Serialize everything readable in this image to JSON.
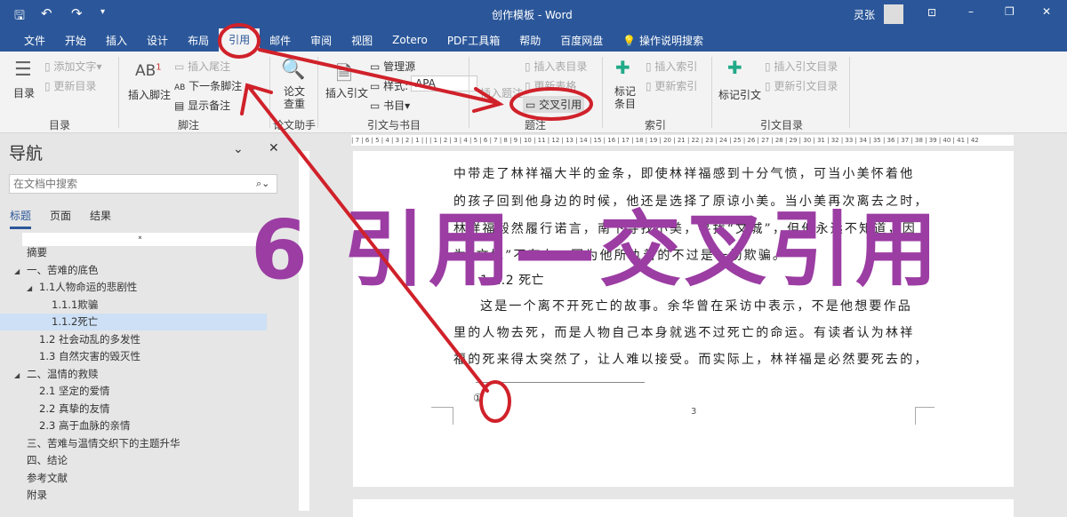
{
  "titlebar": {
    "title": "创作模板 - Word",
    "user": "灵张",
    "qat": {
      "save": "save-icon",
      "undo": "undo-icon",
      "redo": "redo-icon"
    }
  },
  "tabs": [
    "文件",
    "开始",
    "插入",
    "设计",
    "布局",
    "引用",
    "邮件",
    "审阅",
    "视图",
    "Zotero",
    "PDF工具箱",
    "帮助",
    "百度网盘"
  ],
  "tell_me": "操作说明搜索",
  "ribbon": {
    "toc": {
      "toc": "目录",
      "add_text": "添加文字",
      "update": "更新目录",
      "label": "目录"
    },
    "footnote": {
      "insert": "插入脚注",
      "insert_end": "插入尾注",
      "next": "下一条脚注",
      "show": "显示备注",
      "label": "脚注"
    },
    "paper": {
      "check": "论文\n查重",
      "label": "论文助手"
    },
    "citation": {
      "insert": "插入引文",
      "manage": "管理源",
      "style_label": "样式:",
      "style": "APA",
      "bib": "书目",
      "label": "引文与书目"
    },
    "caption": {
      "insert": "插入题注",
      "insert_table": "插入表目录",
      "update_table": "更新表格",
      "cross_ref": "交叉引用",
      "label": "题注"
    },
    "index": {
      "mark": "标记\n条目",
      "insert": "插入索引",
      "update": "更新索引",
      "label": "索引"
    },
    "toa": {
      "mark": "标记引文",
      "insert": "插入引文目录",
      "update": "更新引文目录",
      "label": "引文目录"
    }
  },
  "nav": {
    "title": "导航",
    "search_placeholder": "在文档中搜索",
    "tabs": [
      "标题",
      "页面",
      "结果"
    ],
    "items": [
      {
        "t": "摘要",
        "lvl": 0
      },
      {
        "t": "一、苦难的底色",
        "lvl": 0,
        "exp": true
      },
      {
        "t": "1.1人物命运的悲剧性",
        "lvl": 1,
        "exp": true
      },
      {
        "t": "1.1.1欺骗",
        "lvl": 2
      },
      {
        "t": "1.1.2死亡",
        "lvl": 2,
        "sel": true
      },
      {
        "t": "1.2 社会动乱的多发性",
        "lvl": 1
      },
      {
        "t": "1.3 自然灾害的毁灭性",
        "lvl": 1
      },
      {
        "t": "二、温情的救赎",
        "lvl": 0,
        "exp": true
      },
      {
        "t": "2.1 坚定的爱情",
        "lvl": 1
      },
      {
        "t": "2.2 真挚的友情",
        "lvl": 1
      },
      {
        "t": "2.3 高于血脉的亲情",
        "lvl": 1
      },
      {
        "t": "三、苦难与温情交织下的主题升华",
        "lvl": 0
      },
      {
        "t": "四、结论",
        "lvl": 0
      },
      {
        "t": "参考文献",
        "lvl": 0
      },
      {
        "t": "附录",
        "lvl": 0
      }
    ]
  },
  "doc": {
    "lines": [
      "中带走了林祥福大半的金条，即使林祥福感到十分气愤，可当小美怀着他",
      "的孩子回到他身边的时候，他还是选择了原谅小美。当小美再次离去之时，",
      "林祥福毅然履行诺言，南下寻找小美，寻找“文城”，但他永远不知道，因",
      "为“文城”不存在，因为他所执着的不过是一场欺骗。"
    ],
    "heading": "1.1.2 死亡",
    "lines2": [
      "这是一个离不开死亡的故事。余华曾在采访中表示，不是他想要作品",
      "里的人物去死，而是人物自己本身就逃不过死亡的命运。有读者认为林祥",
      "福的死来得太突然了，让人难以接受。而实际上，林祥福是必然要死去的，"
    ],
    "footnote_mark": "①",
    "page_number": "3"
  },
  "overlay": "6 引用—交叉引用",
  "colors": {
    "accent": "#2b579a",
    "overlay": "#9b3da3",
    "annotation": "#d0212a"
  }
}
